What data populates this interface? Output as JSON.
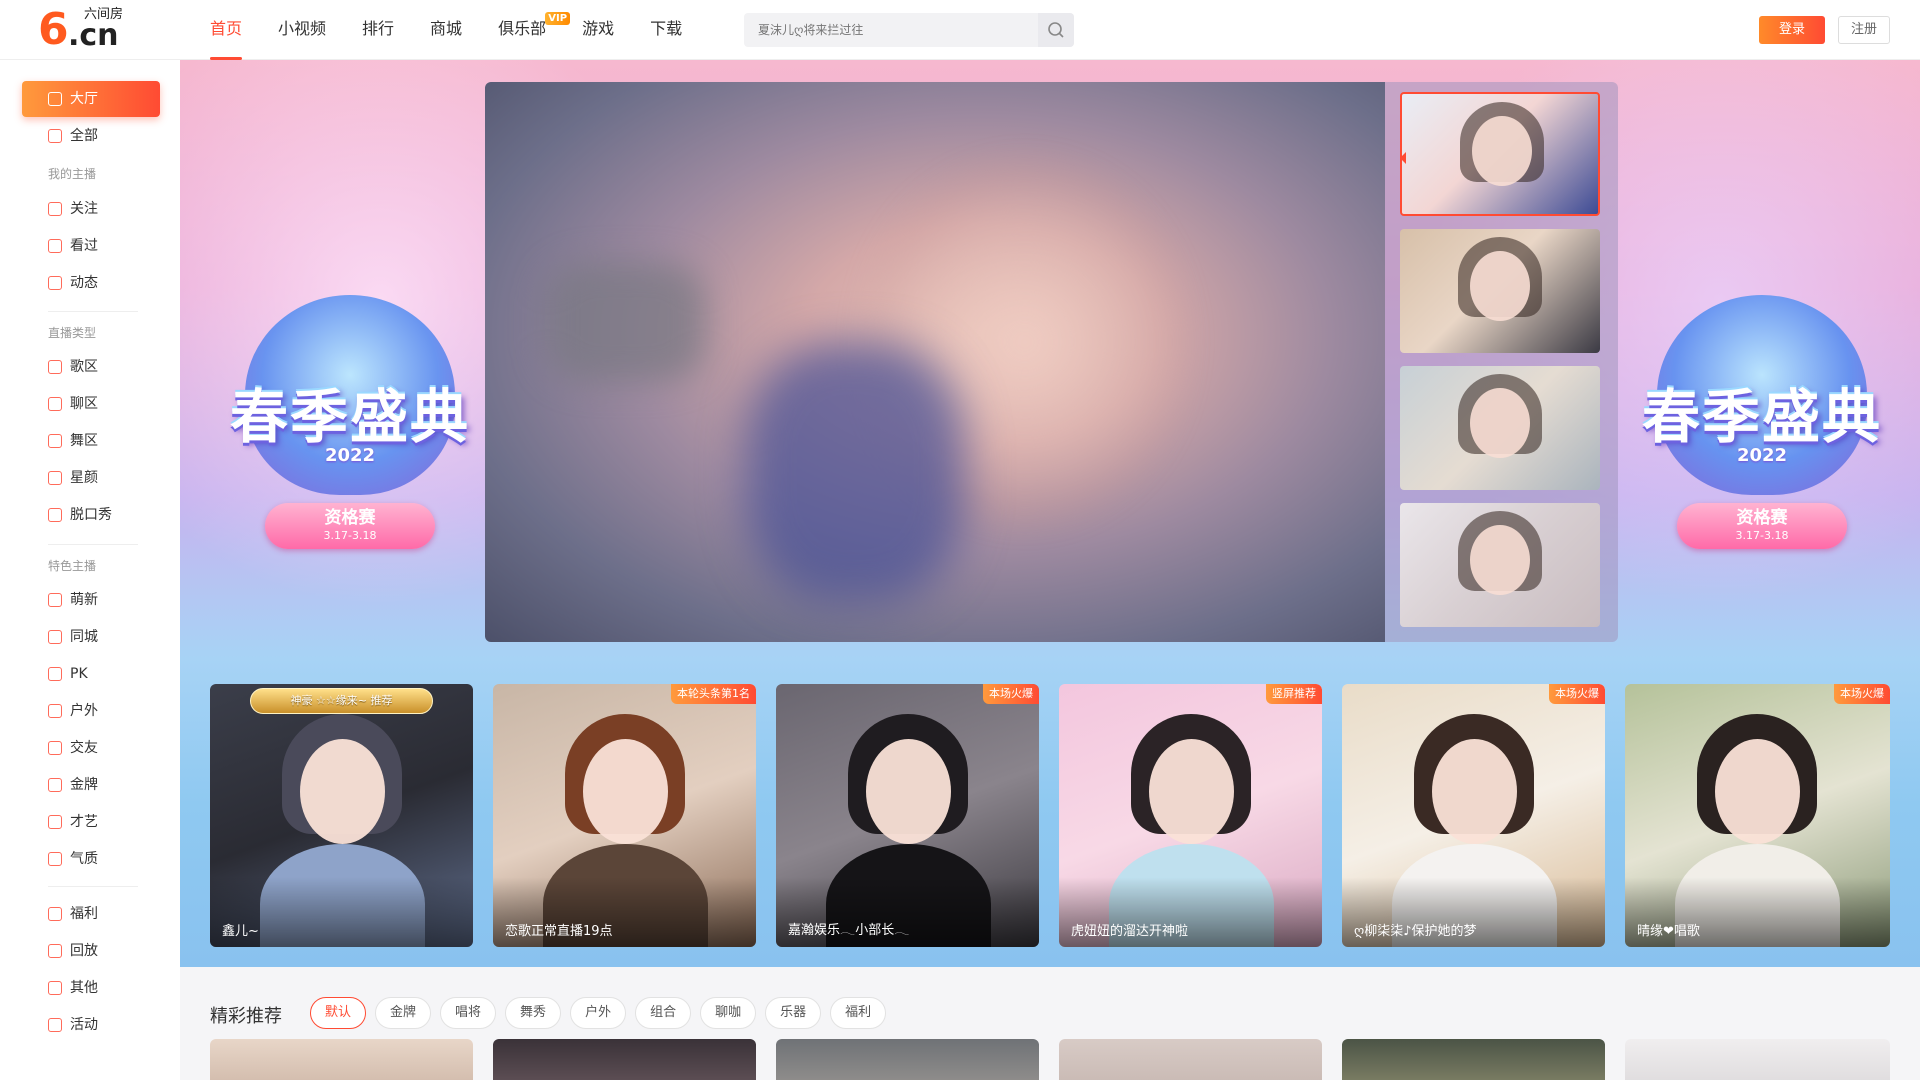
{
  "header": {
    "logo_mark": "6",
    "logo_domain": ".cn",
    "logo_name": "六间房",
    "nav": [
      {
        "label": "首页",
        "active": true
      },
      {
        "label": "小视频"
      },
      {
        "label": "排行"
      },
      {
        "label": "商城"
      },
      {
        "label": "俱乐部",
        "badge": "VIP"
      },
      {
        "label": "游戏"
      },
      {
        "label": "下载"
      }
    ],
    "search_placeholder": "夏沫儿ღ将来拦过往",
    "login_label": "登录",
    "register_label": "注册"
  },
  "sidebar": {
    "items_top": [
      {
        "label": "大厅",
        "icon": "home-icon",
        "active": true
      },
      {
        "label": "全部",
        "icon": "grid-icon"
      }
    ],
    "group_my": "我的主播",
    "items_my": [
      {
        "label": "关注",
        "icon": "heart-icon"
      },
      {
        "label": "看过",
        "icon": "clock-icon"
      },
      {
        "label": "动态",
        "icon": "feed-icon"
      }
    ],
    "group_type": "直播类型",
    "items_type": [
      {
        "label": "歌区",
        "icon": "music-icon"
      },
      {
        "label": "聊区",
        "icon": "chat-icon"
      },
      {
        "label": "舞区",
        "icon": "dance-icon"
      },
      {
        "label": "星颜",
        "icon": "mask-icon"
      },
      {
        "label": "脱口秀",
        "icon": "mic-icon"
      }
    ],
    "group_feature": "特色主播",
    "items_feature": [
      {
        "label": "萌新",
        "icon": "sprout-icon"
      },
      {
        "label": "同城",
        "icon": "location-icon"
      },
      {
        "label": "PK",
        "icon": "lightning-icon"
      },
      {
        "label": "户外",
        "icon": "tent-icon"
      },
      {
        "label": "交友",
        "icon": "friends-icon"
      },
      {
        "label": "金牌",
        "icon": "medal-icon"
      },
      {
        "label": "才艺",
        "icon": "talent-icon"
      },
      {
        "label": "气质",
        "icon": "flag-icon"
      }
    ],
    "items_bottom": [
      {
        "label": "福利",
        "icon": "gift-icon"
      },
      {
        "label": "回放",
        "icon": "replay-icon"
      },
      {
        "label": "其他",
        "icon": "more-icon"
      },
      {
        "label": "活动",
        "icon": "star-icon"
      }
    ]
  },
  "banner": {
    "event_title": "春季盛典",
    "event_year": "2022",
    "event_stage": "资格赛",
    "event_dates": "3.17-3.18"
  },
  "featured": [
    {
      "name": "鑫儿~",
      "crown": "神豪 ☆☆缘来~ 推荐"
    },
    {
      "name": "恋歌正常直播19点",
      "tag": "本轮头条第1名"
    },
    {
      "name": "嘉瀚娱乐𓂃小部长𓂃",
      "tag": "本场火爆"
    },
    {
      "name": "虎妞妞的溜达开神啦",
      "tag": "竖屏推荐"
    },
    {
      "name": "ღ柳柒柒♪保护她的梦",
      "tag": "本场火爆"
    },
    {
      "name": "晴缘❤唱歌",
      "tag": "本场火爆"
    }
  ],
  "recommend": {
    "title": "精彩推荐",
    "filters": [
      "默认",
      "金牌",
      "唱将",
      "舞秀",
      "户外",
      "组合",
      "聊咖",
      "乐器",
      "福利"
    ],
    "active_filter": "默认"
  }
}
